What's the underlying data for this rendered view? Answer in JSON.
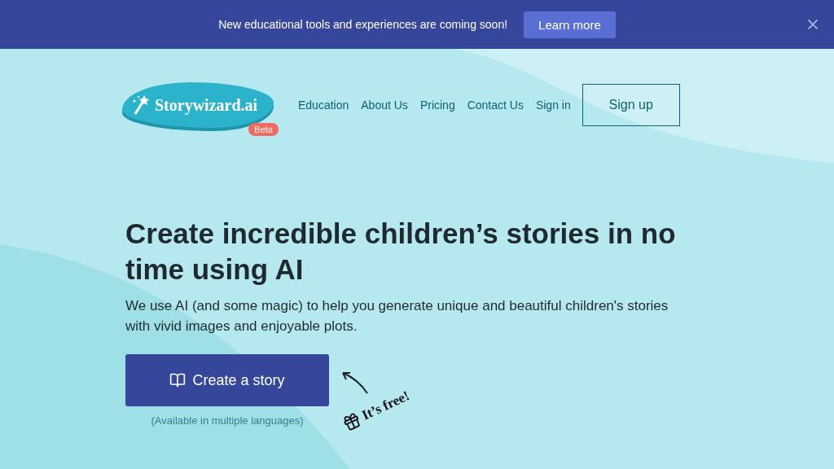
{
  "banner": {
    "text": "New educational tools and experiences are coming soon!",
    "button": "Learn more"
  },
  "logo": {
    "name": "Storywizard.ai",
    "badge": "Beta"
  },
  "nav": {
    "links": [
      "Education",
      "About Us",
      "Pricing",
      "Contact Us",
      "Sign in"
    ],
    "cta": "Sign up"
  },
  "hero": {
    "title": "Create incredible children’s stories in no time using AI",
    "subtitle": "We use AI (and some magic) to help you generate unique and beautiful children's stories with vivid images and enjoyable plots.",
    "button": "Create a story",
    "caption": "(Available in multiple languages)",
    "note": "It’s free!"
  }
}
